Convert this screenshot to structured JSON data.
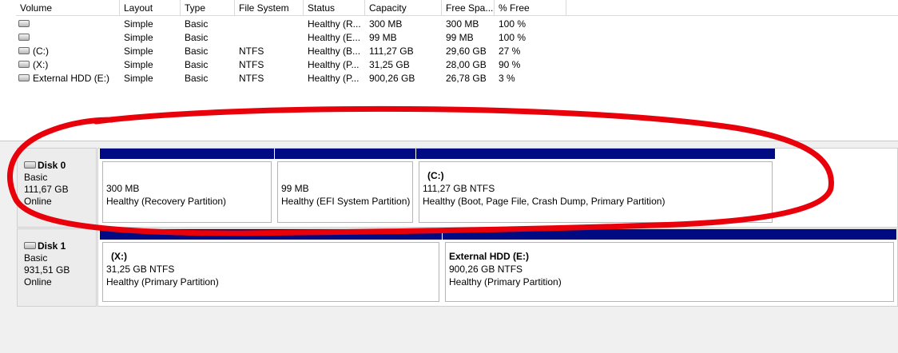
{
  "columns": [
    "Volume",
    "Layout",
    "Type",
    "File System",
    "Status",
    "Capacity",
    "Free Spa...",
    "% Free"
  ],
  "volumes": [
    {
      "volume": "",
      "layout": "Simple",
      "type": "Basic",
      "fs": "",
      "status": "Healthy (R...",
      "capacity": "300 MB",
      "free": "300 MB",
      "pct": "100 %"
    },
    {
      "volume": "",
      "layout": "Simple",
      "type": "Basic",
      "fs": "",
      "status": "Healthy (E...",
      "capacity": "99 MB",
      "free": "99 MB",
      "pct": "100 %"
    },
    {
      "volume": "(C:)",
      "layout": "Simple",
      "type": "Basic",
      "fs": "NTFS",
      "status": "Healthy (B...",
      "capacity": "111,27 GB",
      "free": "29,60 GB",
      "pct": "27 %"
    },
    {
      "volume": "(X:)",
      "layout": "Simple",
      "type": "Basic",
      "fs": "NTFS",
      "status": "Healthy (P...",
      "capacity": "31,25 GB",
      "free": "28,00 GB",
      "pct": "90 %"
    },
    {
      "volume": "External HDD (E:)",
      "layout": "Simple",
      "type": "Basic",
      "fs": "NTFS",
      "status": "Healthy (P...",
      "capacity": "900,26 GB",
      "free": "26,78 GB",
      "pct": "3 %"
    }
  ],
  "disks": [
    {
      "name": "Disk 0",
      "type": "Basic",
      "size": "111,67 GB",
      "state": "Online",
      "partitions": [
        {
          "name": "",
          "size": "300 MB",
          "status": "Healthy (Recovery Partition)"
        },
        {
          "name": "",
          "size": "99 MB",
          "status": "Healthy (EFI System Partition)"
        },
        {
          "name": "(C:)",
          "size": "111,27 GB NTFS",
          "status": "Healthy (Boot, Page File, Crash Dump, Primary Partition)"
        }
      ]
    },
    {
      "name": "Disk 1",
      "type": "Basic",
      "size": "931,51 GB",
      "state": "Online",
      "partitions": [
        {
          "name": "(X:)",
          "size": "31,25 GB NTFS",
          "status": "Healthy (Primary Partition)"
        },
        {
          "name": "External HDD  (E:)",
          "size": "900,26 GB NTFS",
          "status": "Healthy (Primary Partition)"
        }
      ]
    }
  ],
  "colors": {
    "partition_bar": "#000a82",
    "annotation": "#e8000b"
  }
}
